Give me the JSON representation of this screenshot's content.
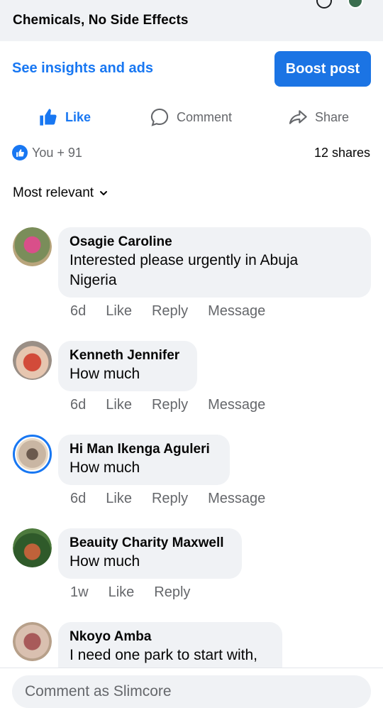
{
  "post": {
    "title_fragment": "Chemicals, No Side Effects"
  },
  "insights": {
    "link_label": "See insights and ads",
    "boost_label": "Boost post"
  },
  "actions": {
    "like_label": "Like",
    "comment_label": "Comment",
    "share_label": "Share"
  },
  "reactions": {
    "summary": "You + 91",
    "shares": "12 shares"
  },
  "sort": {
    "label": "Most relevant"
  },
  "comments": [
    {
      "name": "Osagie Caroline",
      "lines": [
        "Interested please urgently in Abuja",
        "Nigeria"
      ],
      "time": "6d",
      "actions": [
        "Like",
        "Reply",
        "Message"
      ]
    },
    {
      "name": "Kenneth Jennifer",
      "lines": [
        "How much"
      ],
      "time": "6d",
      "actions": [
        "Like",
        "Reply",
        "Message"
      ]
    },
    {
      "name": "Hi Man Ikenga Aguleri",
      "lines": [
        "How much"
      ],
      "time": "6d",
      "actions": [
        "Like",
        "Reply",
        "Message"
      ]
    },
    {
      "name": "Beauity Charity Maxwell",
      "lines": [
        "How much"
      ],
      "time": "1w",
      "actions": [
        "Like",
        "Reply"
      ]
    },
    {
      "name": "Nkoyo Amba",
      "lines": [
        "I need one park to start with,"
      ]
    }
  ],
  "composer": {
    "placeholder": "Comment as Slimcore"
  },
  "colors": {
    "accent": "#1877f2",
    "bubble": "#f0f2f5",
    "muted_text": "#65676b"
  },
  "icons": [
    "thumbs-up-icon",
    "comment-bubble-icon",
    "share-arrow-icon",
    "chevron-down-icon",
    "search-icon",
    "avatar"
  ]
}
